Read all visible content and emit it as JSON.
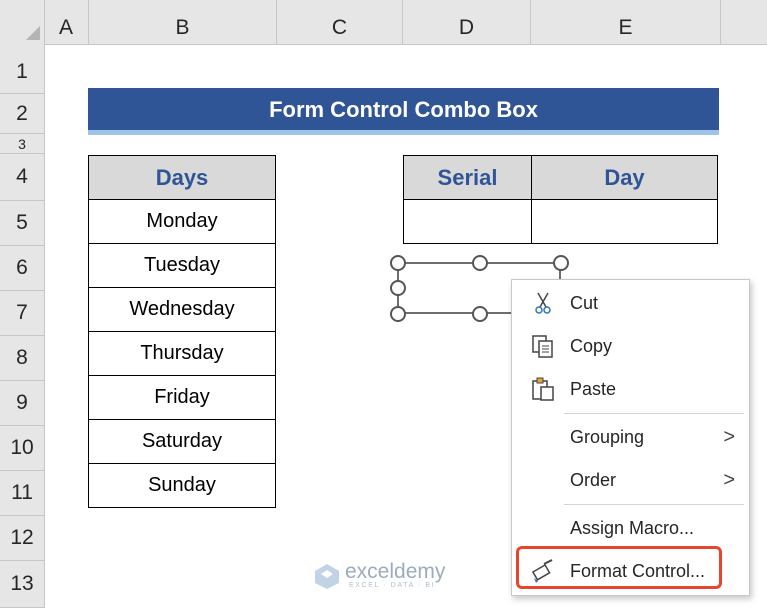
{
  "columns": [
    "A",
    "B",
    "C",
    "D",
    "E"
  ],
  "rows": [
    "1",
    "2",
    "3",
    "4",
    "5",
    "6",
    "7",
    "8",
    "9",
    "10",
    "11",
    "12",
    "13"
  ],
  "title": "Form Control Combo Box",
  "days_table": {
    "header": "Days",
    "items": [
      "Monday",
      "Tuesday",
      "Wednesday",
      "Thursday",
      "Friday",
      "Saturday",
      "Sunday"
    ]
  },
  "serial_table": {
    "headers": [
      "Serial",
      "Day"
    ],
    "values": [
      "",
      ""
    ]
  },
  "context_menu": {
    "cut": "Cut",
    "copy": "Copy",
    "paste": "Paste",
    "grouping": "Grouping",
    "order": "Order",
    "assign_macro": "Assign Macro...",
    "format_control": "Format Control...",
    "submenu_arrow": ">"
  },
  "watermark": {
    "name": "exceldemy",
    "tagline": "EXCEL · DATA · BI"
  },
  "colors": {
    "title_bg": "#2f5597",
    "header_text": "#2f5597",
    "highlight": "#e8452c"
  }
}
